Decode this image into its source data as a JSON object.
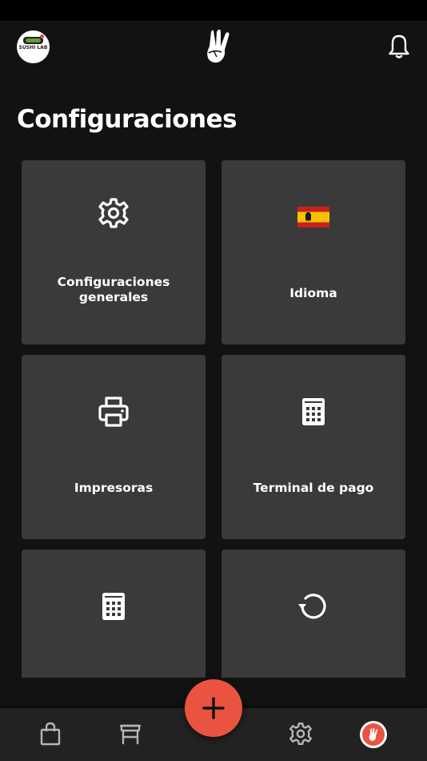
{
  "header": {
    "brand_text": "SUSHI LAB",
    "logo_icon": "peace-hand-icon",
    "notifications_icon": "bell-icon"
  },
  "page": {
    "title": "Configuraciones"
  },
  "tiles": [
    {
      "label": "Configuraciones generales",
      "icon": "gear-icon"
    },
    {
      "label": "Idioma",
      "icon": "spain-flag-icon"
    },
    {
      "label": "Impresoras",
      "icon": "printer-icon"
    },
    {
      "label": "Terminal de pago",
      "icon": "calculator-icon"
    },
    {
      "label": "",
      "icon": "calculator-icon"
    },
    {
      "label": "",
      "icon": "refresh-icon"
    }
  ],
  "bottom_nav": {
    "items": [
      "shopping-bag-icon",
      "table-icon",
      "add-icon",
      "gear-icon",
      "profile-icon"
    ]
  },
  "colors": {
    "accent": "#e9533f",
    "tile_bg": "#3a3a3a",
    "app_bg": "#121212",
    "flag_red": "#c8201e",
    "flag_yellow": "#f5c200"
  }
}
